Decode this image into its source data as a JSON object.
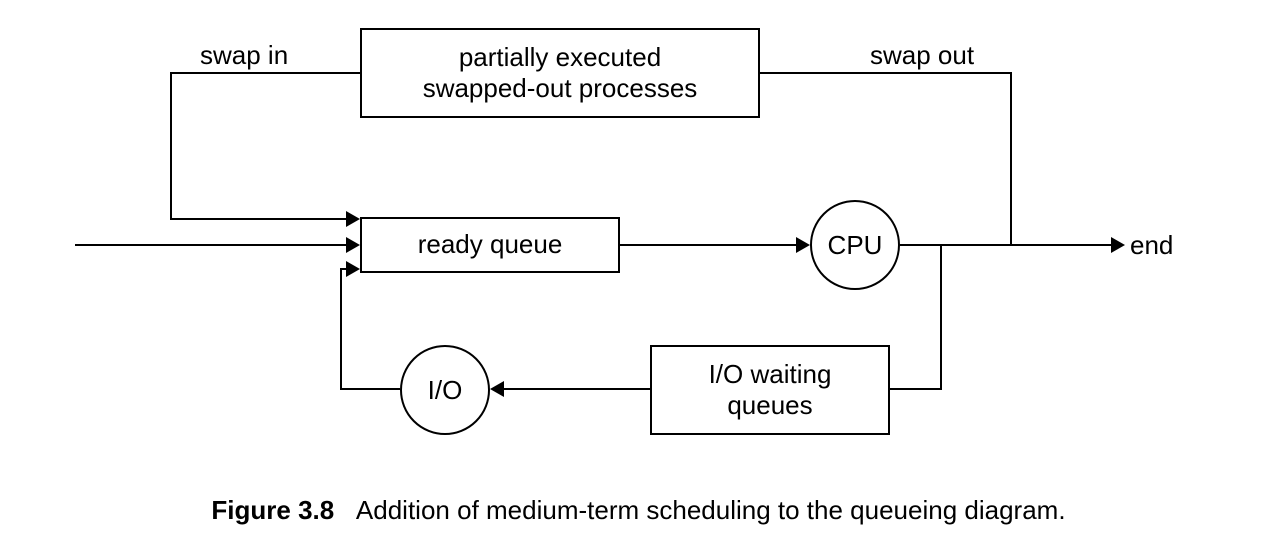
{
  "figure_number": "Figure 3.8",
  "caption_text": "Addition of medium-term scheduling to the queueing diagram.",
  "labels": {
    "swap_in": "swap in",
    "swap_out": "swap out",
    "end": "end"
  },
  "nodes": {
    "swapped_out_box": "partially executed\nswapped-out processes",
    "ready_queue": "ready queue",
    "cpu": "CPU",
    "io": "I/O",
    "io_waiting": "I/O waiting\nqueues"
  },
  "chart_data": {
    "type": "diagram",
    "title": "Addition of medium-term scheduling to the queueing diagram.",
    "nodes": [
      {
        "id": "start",
        "kind": "entry",
        "label": ""
      },
      {
        "id": "ready",
        "kind": "queue-box",
        "label": "ready queue"
      },
      {
        "id": "cpu",
        "kind": "processor-circle",
        "label": "CPU"
      },
      {
        "id": "end",
        "kind": "exit",
        "label": "end"
      },
      {
        "id": "swapped",
        "kind": "box",
        "label": "partially executed swapped-out processes"
      },
      {
        "id": "iowait",
        "kind": "queue-box",
        "label": "I/O waiting queues"
      },
      {
        "id": "io",
        "kind": "device-circle",
        "label": "I/O"
      }
    ],
    "edges": [
      {
        "from": "start",
        "to": "ready",
        "label": ""
      },
      {
        "from": "ready",
        "to": "cpu",
        "label": ""
      },
      {
        "from": "cpu",
        "to": "end",
        "label": ""
      },
      {
        "from": "cpu",
        "to": "swapped",
        "label": "swap out"
      },
      {
        "from": "swapped",
        "to": "ready",
        "label": "swap in"
      },
      {
        "from": "cpu",
        "to": "iowait",
        "label": ""
      },
      {
        "from": "iowait",
        "to": "io",
        "label": ""
      },
      {
        "from": "io",
        "to": "ready",
        "label": ""
      }
    ]
  }
}
